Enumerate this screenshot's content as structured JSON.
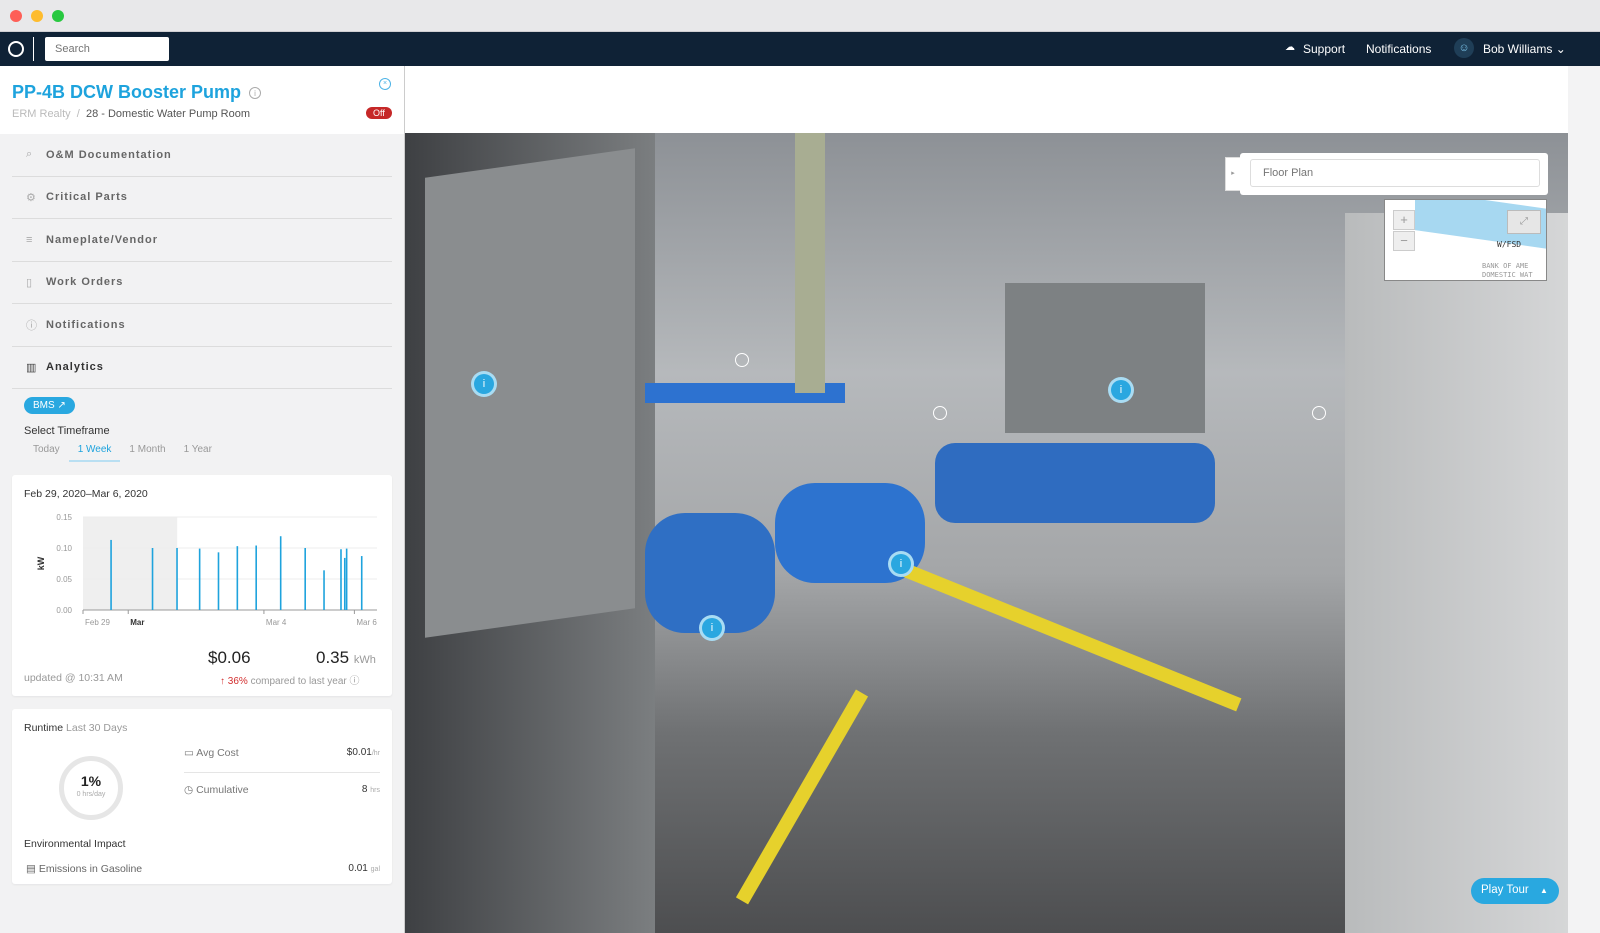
{
  "colors": {
    "accent": "#1ea3dd",
    "nav_bg": "#0f2236",
    "status_off": "#c62828",
    "bar": "#1ea3dd"
  },
  "window": {
    "buttons": [
      "close",
      "minimize",
      "maximize"
    ]
  },
  "topnav": {
    "logo": "logo-icon",
    "search_placeholder": "Search",
    "support": "Support",
    "notifications": "Notifications",
    "user": "Bob Williams"
  },
  "asset": {
    "title": "PP-4B DCW Booster Pump",
    "breadcrumb": [
      "ERM Realty",
      "28 - Domestic Water Pump Room"
    ],
    "status": "Off"
  },
  "menu": [
    {
      "label": "O&M Documentation",
      "icon": "paperclip-icon"
    },
    {
      "label": "Critical Parts",
      "icon": "parts-icon"
    },
    {
      "label": "Nameplate/Vendor",
      "icon": "list-icon"
    },
    {
      "label": "Work Orders",
      "icon": "document-icon"
    },
    {
      "label": "Notifications",
      "icon": "alert-icon"
    },
    {
      "label": "Analytics",
      "icon": "bar-chart-icon",
      "active": true
    }
  ],
  "analytics": {
    "bms_label": "BMS",
    "select_timeframe": "Select Timeframe",
    "timeframes": [
      "Today",
      "1 Week",
      "1 Month",
      "1 Year"
    ],
    "active_timeframe": "1 Week",
    "date_range": "Feb 29, 2020–Mar 6, 2020",
    "cost": "$0.06",
    "energy": "0.35",
    "energy_unit": "kWh",
    "updated": "updated @ 10:31 AM",
    "change_pct": "36%",
    "change_text": "compared to last year"
  },
  "chart_data": {
    "type": "bar",
    "ylabel": "kW",
    "ylim": [
      0,
      0.15
    ],
    "yticks": [
      "0.00",
      "0.05",
      "0.10",
      "0.15"
    ],
    "xlim": [
      "2020-02-29T00:00",
      "2020-03-06T12:00"
    ],
    "xticks": [
      {
        "label": "Feb 29",
        "t": "2020-02-29T00:00"
      },
      {
        "label": "Mar",
        "t": "2020-03-01T00:00",
        "bold": true
      },
      {
        "label": "Mar 4",
        "t": "2020-03-04T00:00"
      },
      {
        "label": "Mar 6",
        "t": "2020-03-06T00:00"
      }
    ],
    "highlighted_range": [
      "2020-02-29T00:00",
      "2020-03-02T02:00"
    ],
    "grid": true,
    "points": [
      {
        "t": "2020-02-29T15:00",
        "v": 0.113
      },
      {
        "t": "2020-03-01T13:00",
        "v": 0.1
      },
      {
        "t": "2020-03-02T02:00",
        "v": 0.1
      },
      {
        "t": "2020-03-02T14:00",
        "v": 0.099
      },
      {
        "t": "2020-03-03T00:00",
        "v": 0.093
      },
      {
        "t": "2020-03-03T10:00",
        "v": 0.103
      },
      {
        "t": "2020-03-03T20:00",
        "v": 0.104
      },
      {
        "t": "2020-03-04T09:00",
        "v": 0.119
      },
      {
        "t": "2020-03-04T22:00",
        "v": 0.1
      },
      {
        "t": "2020-03-05T08:00",
        "v": 0.064
      },
      {
        "t": "2020-03-05T17:00",
        "v": 0.098
      },
      {
        "t": "2020-03-05T19:00",
        "v": 0.084
      },
      {
        "t": "2020-03-05T20:00",
        "v": 0.099
      },
      {
        "t": "2020-03-06T04:00",
        "v": 0.087
      }
    ]
  },
  "runtime": {
    "title": "Runtime",
    "subtitle": "Last 30 Days",
    "percent": "1%",
    "percent_value": 1,
    "per_day": "0 hrs/day",
    "avg_cost_label": "Avg Cost",
    "avg_cost": "$0.01",
    "avg_cost_unit": "/hr",
    "cumulative_label": "Cumulative",
    "cumulative": "8",
    "cumulative_unit": "hrs",
    "env_title": "Environmental Impact",
    "emissions_label": "Emissions in Gasoline",
    "emissions": "0.01",
    "emissions_unit": "gal"
  },
  "viewer": {
    "floor_plan_placeholder": "Floor Plan",
    "play_tour": "Play Tour",
    "minimap_labels": [
      "W/FSD",
      "BANK OF AME",
      "DOMESTIC WAT"
    ]
  }
}
